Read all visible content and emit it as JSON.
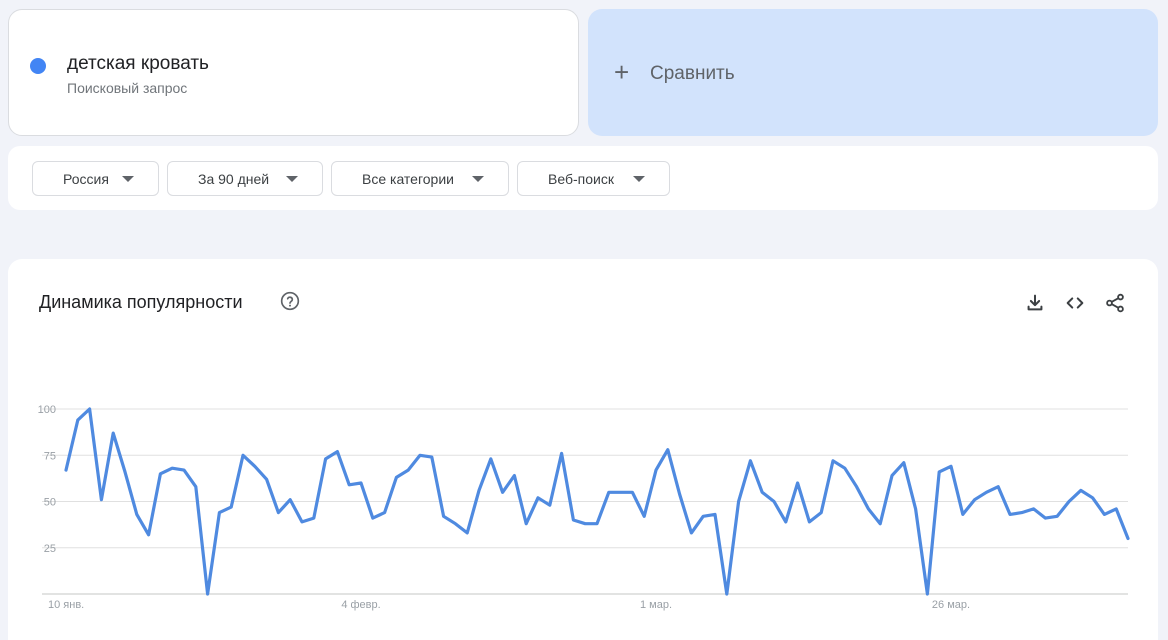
{
  "term": {
    "name": "детская кровать",
    "type": "Поисковый запрос",
    "color": "#4285f4"
  },
  "compare": {
    "icon": "plus-icon",
    "label": "Сравнить"
  },
  "filters": [
    {
      "label": "Россия"
    },
    {
      "label": "За 90 дней"
    },
    {
      "label": "Все категории"
    },
    {
      "label": "Веб-поиск"
    }
  ],
  "chart_card": {
    "title": "Динамика популярности",
    "icons": [
      "help-icon",
      "download-icon",
      "embed-icon",
      "share-icon"
    ]
  },
  "chart_data": {
    "type": "line",
    "title": "Динамика популярности",
    "xlabel": "",
    "ylabel": "",
    "ylim": [
      0,
      100
    ],
    "yticks": [
      25,
      50,
      75,
      100
    ],
    "grid": true,
    "line_color": "#4f8ae0",
    "x_start_label_index": 0,
    "xticks": [
      {
        "index": 0,
        "label": "10 янв."
      },
      {
        "index": 25,
        "label": "4 февр."
      },
      {
        "index": 50,
        "label": "1 мар."
      },
      {
        "index": 75,
        "label": "26 мар."
      }
    ],
    "x": [
      "10 янв.",
      "11 янв.",
      "12 янв.",
      "13 янв.",
      "14 янв.",
      "15 янв.",
      "16 янв.",
      "17 янв.",
      "18 янв.",
      "19 янв.",
      "20 янв.",
      "21 янв.",
      "22 янв.",
      "23 янв.",
      "24 янв.",
      "25 янв.",
      "26 янв.",
      "27 янв.",
      "28 янв.",
      "29 янв.",
      "30 янв.",
      "31 янв.",
      "1 февр.",
      "2 февр.",
      "3 февр.",
      "4 февр.",
      "5 февр.",
      "6 февр.",
      "7 февр.",
      "8 февр.",
      "9 февр.",
      "10 февр.",
      "11 февр.",
      "12 февр.",
      "13 февр.",
      "14 февр.",
      "15 февр.",
      "16 февр.",
      "17 февр.",
      "18 февр.",
      "19 февр.",
      "20 февр.",
      "21 февр.",
      "22 февр.",
      "23 февр.",
      "24 февр.",
      "25 февр.",
      "26 февр.",
      "27 февр.",
      "28 февр.",
      "1 мар.",
      "2 мар.",
      "3 мар.",
      "4 мар.",
      "5 мар.",
      "6 мар.",
      "7 мар.",
      "8 мар.",
      "9 мар.",
      "10 мар.",
      "11 мар.",
      "12 мар.",
      "13 мар.",
      "14 мар.",
      "15 мар.",
      "16 мар.",
      "17 мар.",
      "18 мар.",
      "19 мар.",
      "20 мар.",
      "21 мар.",
      "22 мар.",
      "23 мар.",
      "24 мар.",
      "25 мар.",
      "26 мар.",
      "27 мар.",
      "28 мар.",
      "29 мар.",
      "30 мар.",
      "31 мар.",
      "1 апр.",
      "2 апр.",
      "3 апр.",
      "4 апр.",
      "5 апр.",
      "6 апр.",
      "7 апр.",
      "8 апр.",
      "9 апр.",
      "10 апр.",
      "11 апр.",
      "12 апр."
    ],
    "series": [
      {
        "values": [
          67,
          94,
          100,
          51,
          87,
          66,
          43,
          32,
          65,
          68,
          67,
          58,
          0,
          44,
          47,
          75,
          69,
          62,
          44,
          51,
          39,
          41,
          73,
          77,
          59,
          60,
          41,
          44,
          63,
          67,
          75,
          74,
          42,
          38,
          33,
          56,
          73,
          55,
          64,
          38,
          52,
          48,
          76,
          40,
          38,
          38,
          55,
          55,
          55,
          42,
          67,
          78,
          54,
          33,
          42,
          43,
          0,
          50,
          72,
          55,
          50,
          39,
          60,
          39,
          44,
          72,
          68,
          58,
          46,
          38,
          64,
          71,
          46,
          0,
          66,
          69,
          43,
          51,
          55,
          58,
          43,
          44,
          46,
          41,
          42,
          50,
          56,
          52,
          43,
          46,
          30
        ]
      }
    ]
  }
}
